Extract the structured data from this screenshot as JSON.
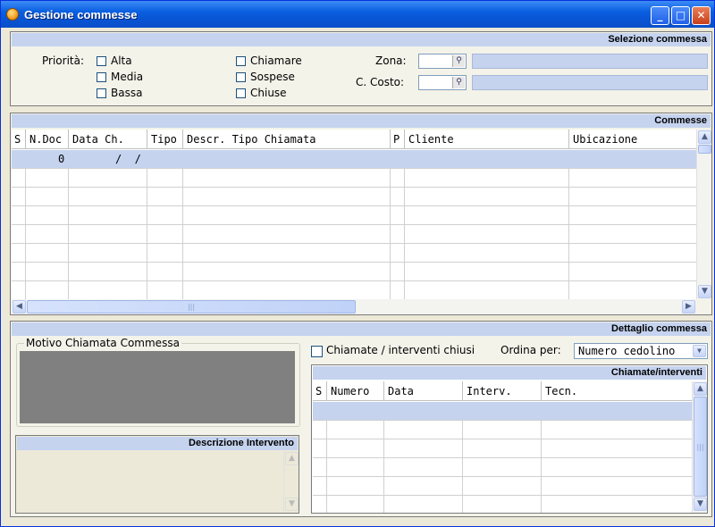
{
  "window": {
    "title": "Gestione commesse",
    "controls": {
      "minimize": "_",
      "maximize": "□",
      "close": "✕"
    }
  },
  "selezione": {
    "header": "Selezione commessa",
    "priorita_label": "Priorità:",
    "priority_options": [
      "Alta",
      "Media",
      "Bassa"
    ],
    "status_options": [
      "Chiamare",
      "Sospese",
      "Chiuse"
    ],
    "zona_label": "Zona:",
    "costo_label": "C. Costo:"
  },
  "commesse": {
    "header": "Commesse",
    "columns": [
      "S",
      "N.Doc",
      "Data Ch.",
      "Tipo",
      "Descr. Tipo Chiamata",
      "P",
      "Cliente",
      "Ubicazione"
    ],
    "first_row": {
      "ndoc": "0",
      "data": "/  /"
    }
  },
  "dettaglio": {
    "header": "Dettaglio commessa",
    "motivo_title": "Motivo Chiamata Commessa",
    "descrizione_header": "Descrizione Intervento",
    "chiusi_label": "Chiamate / interventi chiusi",
    "ordina_label": "Ordina per:",
    "ordina_value": "Numero cedolino",
    "interventi_header": "Chiamate/interventi",
    "interventi_columns": [
      "S",
      "Numero",
      "Data",
      "Interv.",
      "Tecn."
    ]
  },
  "icons": {
    "app": "gear-icon",
    "lookup": "magnifier-icon",
    "scroll_up": "▲",
    "scroll_down": "▼",
    "scroll_left": "◀",
    "scroll_right": "▶",
    "grip": "|||",
    "dropdown": "▼"
  },
  "colors": {
    "titlebar": "#0854d4",
    "band": "#c5d3ef",
    "window_bg": "#ece9d8",
    "panel_bg": "#f4f3ea",
    "memo_grey": "#808080"
  }
}
